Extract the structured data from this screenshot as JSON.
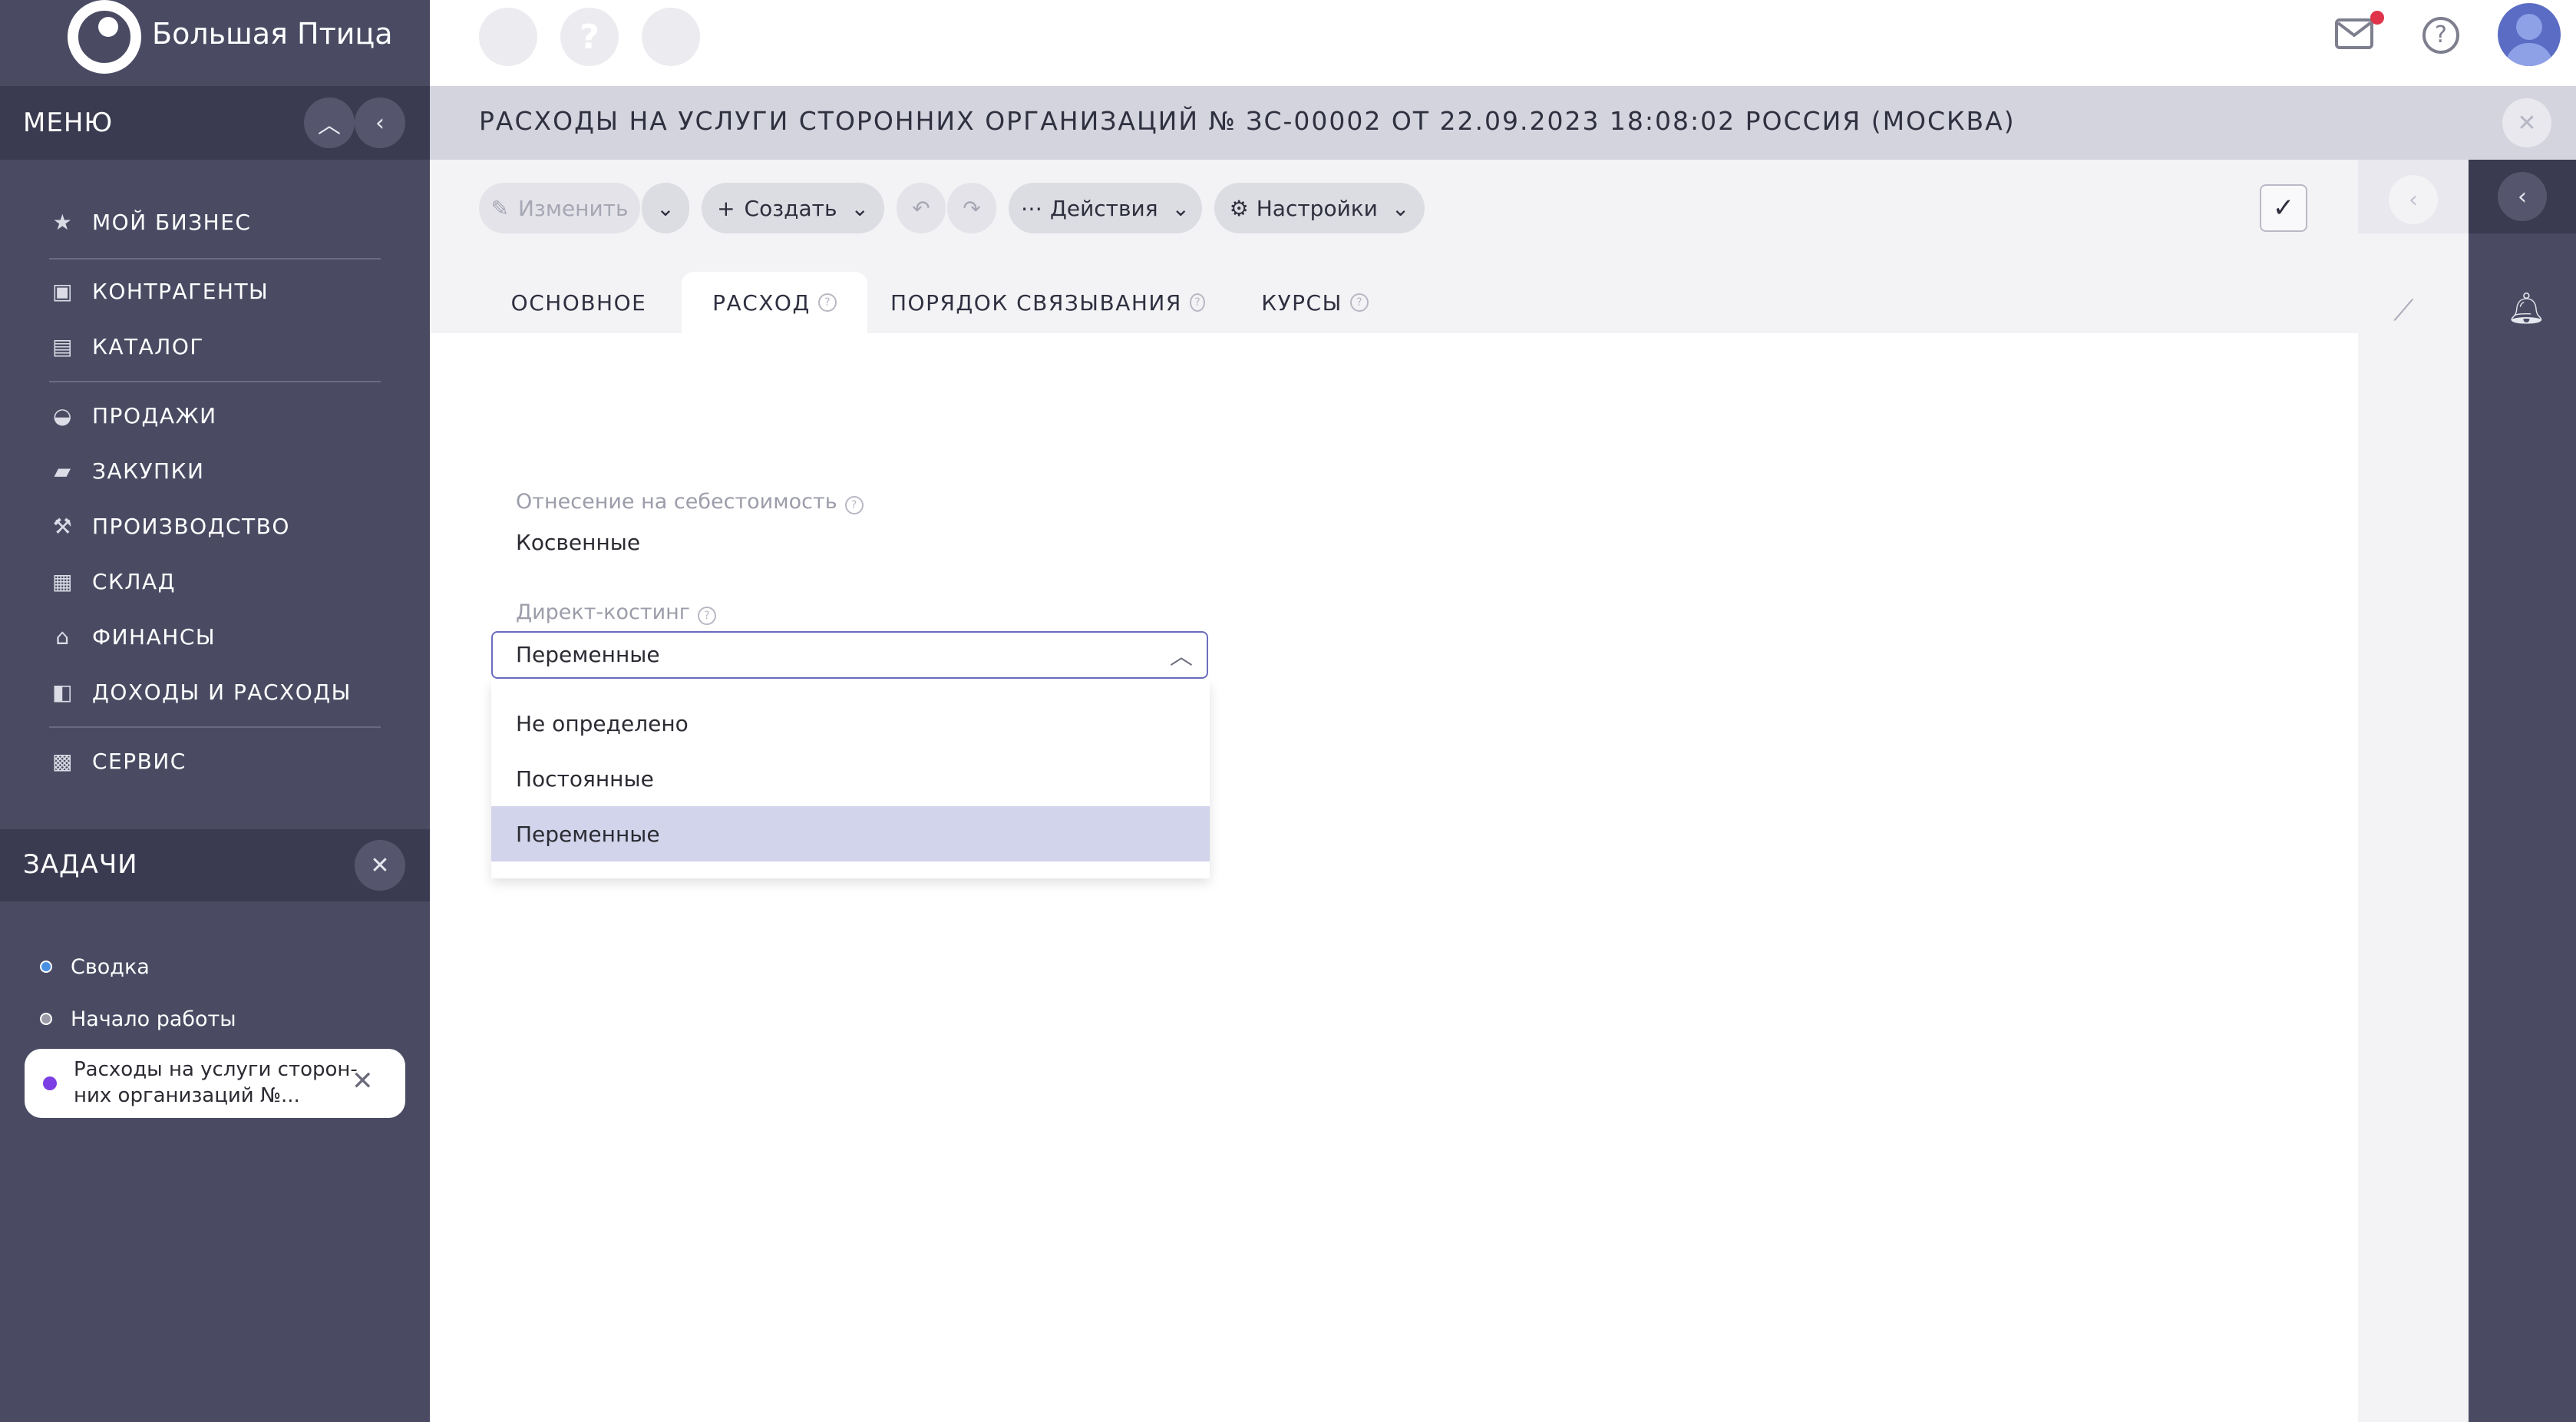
{
  "brand": {
    "name": "Большая Птица"
  },
  "menu": {
    "title": "МЕНЮ",
    "items": [
      {
        "label": "МОЙ БИЗНЕС",
        "icon": "star-icon"
      },
      {
        "label": "КОНТРАГЕНТЫ",
        "icon": "briefcase-icon"
      },
      {
        "label": "КАТАЛОГ",
        "icon": "book-icon"
      },
      {
        "label": "ПРОДАЖИ",
        "icon": "basket-icon"
      },
      {
        "label": "ЗАКУПКИ",
        "icon": "truck-icon"
      },
      {
        "label": "ПРОИЗВОДСТВО",
        "icon": "factory-icon"
      },
      {
        "label": "СКЛАД",
        "icon": "warehouse-icon"
      },
      {
        "label": "ФИНАНСЫ",
        "icon": "bank-icon"
      },
      {
        "label": "ДОХОДЫ И РАСХОДЫ",
        "icon": "wallet-icon"
      },
      {
        "label": "СЕРВИС",
        "icon": "service-icon"
      }
    ]
  },
  "tasks": {
    "title": "ЗАДАЧИ",
    "items": [
      {
        "label": "Сводка",
        "color": "#4a90e2"
      },
      {
        "label": "Начало работы",
        "color": "#9a9aa6"
      },
      {
        "label_line1": "Расходы на услуги сторон-",
        "label_line2": "них организаций №...",
        "color": "#7b3fe4"
      }
    ]
  },
  "document": {
    "title": "РАСХОДЫ НА УСЛУГИ СТОРОННИХ ОРГАНИЗАЦИЙ № ЗС-00002 ОТ 22.09.2023 18:08:02 РОССИЯ (МОСКВА)"
  },
  "toolbar": {
    "edit_label": "Изменить",
    "create_label": "Создать",
    "actions_label": "Действия",
    "settings_label": "Настройки"
  },
  "tabs": [
    {
      "label": "ОСНОВНОЕ",
      "active": false
    },
    {
      "label": "РАСХОД",
      "active": true
    },
    {
      "label": "ПОРЯДОК СВЯЗЫВАНИЯ",
      "active": false
    },
    {
      "label": "КУРСЫ",
      "active": false
    }
  ],
  "form": {
    "cost_attribution": {
      "label": "Отнесение на себестоимость",
      "value": "Косвенные"
    },
    "direct_costing": {
      "label": "Директ-костинг",
      "value": "Переменные",
      "options": [
        "Не определено",
        "Постоянные",
        "Переменные"
      ],
      "selected": "Переменные"
    }
  },
  "colors": {
    "sidebar": "#4a4b63",
    "accent": "#6a6dbd",
    "notification": "#e0344a"
  }
}
